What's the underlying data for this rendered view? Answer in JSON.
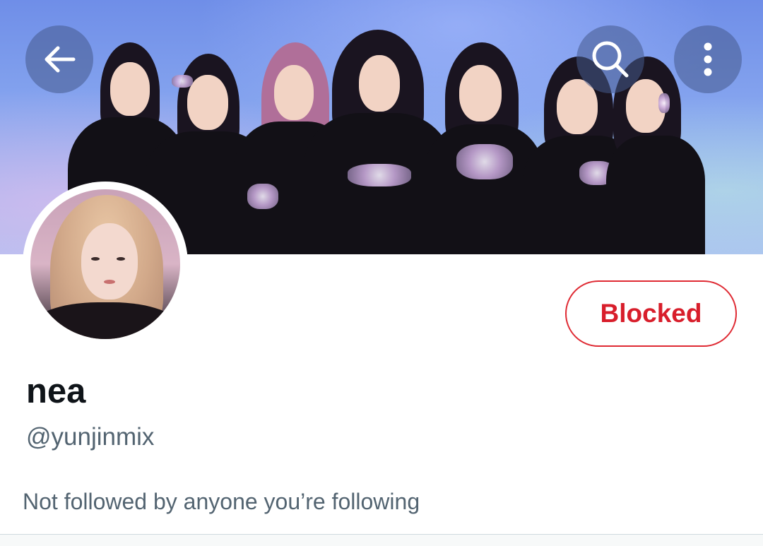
{
  "header": {
    "back_icon": "arrow-left-icon",
    "search_icon": "search-icon",
    "more_icon": "more-vertical-icon"
  },
  "profile": {
    "display_name": "nea",
    "handle": "@yunjinmix",
    "followers_you_know": "Not followed by anyone you’re following",
    "relationship_button": "Blocked"
  },
  "colors": {
    "blocked_red": "#d81e2b",
    "secondary_text": "#536471",
    "primary_text": "#0f1419"
  }
}
